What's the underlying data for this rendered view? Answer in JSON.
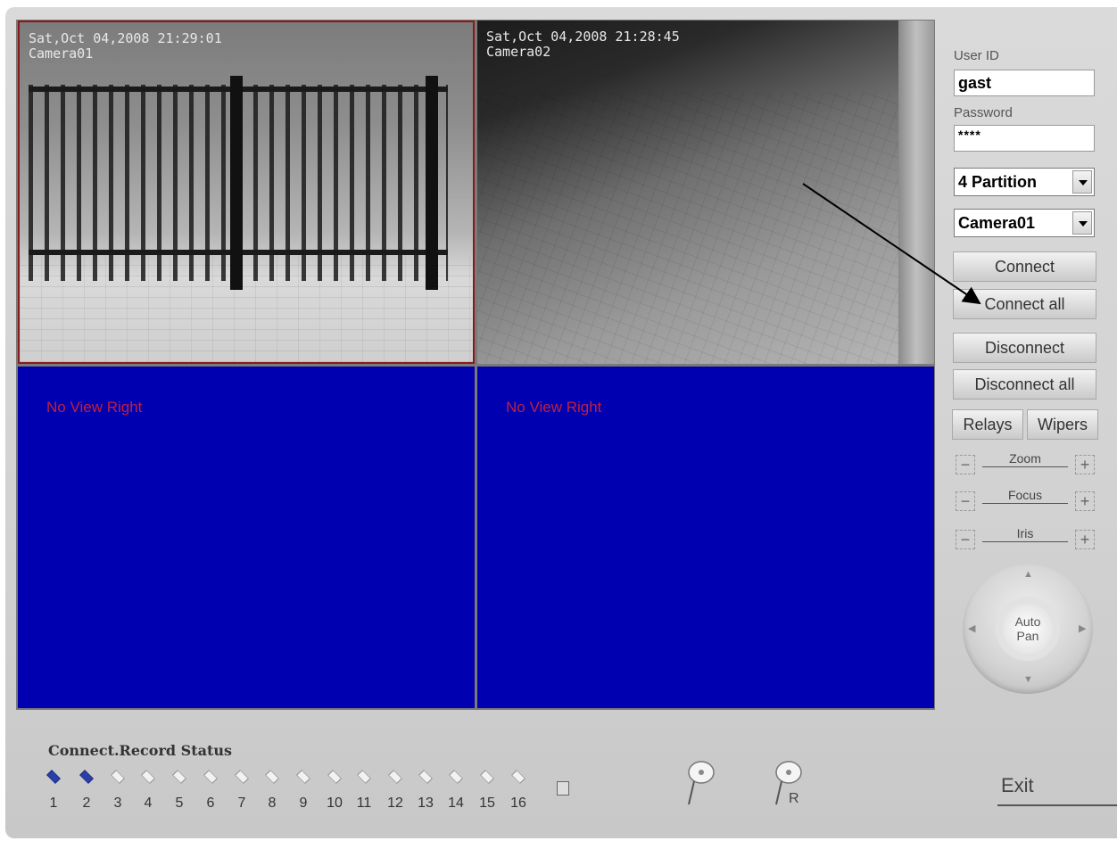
{
  "cameras": [
    {
      "datetime": "Sat,Oct 04,2008 21:29:01",
      "name": "Camera01"
    },
    {
      "datetime": "Sat,Oct 04,2008 21:28:45",
      "name": "Camera02"
    }
  ],
  "no_view_text": "No View Right",
  "panel": {
    "user_id_label": "User ID",
    "user_id_value": "gast",
    "password_label": "Password",
    "password_value": "****",
    "partition_select": "4 Partition",
    "camera_select": "Camera01",
    "connect": "Connect",
    "connect_all": "Connect all",
    "disconnect": "Disconnect",
    "disconnect_all": "Disconnect all",
    "relays": "Relays",
    "wipers": "Wipers",
    "zoom": "Zoom",
    "focus": "Focus",
    "iris": "Iris",
    "auto_pan_line1": "Auto",
    "auto_pan_line2": "Pan"
  },
  "status": {
    "title": "Connect.Record Status",
    "channels": [
      "1",
      "2",
      "3",
      "4",
      "5",
      "6",
      "7",
      "8",
      "9",
      "10",
      "11",
      "12",
      "13",
      "14",
      "15",
      "16"
    ],
    "active": [
      true,
      true,
      false,
      false,
      false,
      false,
      false,
      false,
      false,
      false,
      false,
      false,
      false,
      false,
      false,
      false
    ]
  },
  "record_icon_label": "R",
  "exit": "Exit",
  "colors": {
    "no_view_bg": "#0000b0",
    "no_view_text": "#c02040",
    "active_channel": "#2a3fa8"
  }
}
